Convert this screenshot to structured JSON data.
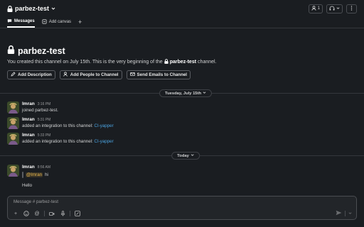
{
  "header": {
    "channel_name": "parbez-test",
    "member_count": "1"
  },
  "tabs": [
    {
      "label": "Messages"
    },
    {
      "label": "Add canvas"
    }
  ],
  "intro": {
    "title": "parbez-test",
    "desc_prefix": "You created this channel on July 15th. This is the very beginning of the",
    "desc_channel": "parbez-test",
    "desc_suffix": "channel.",
    "actions": [
      {
        "label": "Add Description"
      },
      {
        "label": "Add People to Channel"
      },
      {
        "label": "Send Emails to Channel"
      }
    ]
  },
  "date_dividers": [
    {
      "label": "Tuesday, July 15th"
    },
    {
      "label": "Today"
    }
  ],
  "messages": [
    {
      "author": "Imran",
      "time": "3:16 PM",
      "text": "joined parbez-test."
    },
    {
      "author": "Imran",
      "time": "5:31 PM",
      "text": "added an integration to this channel:",
      "link": "CI-yapper"
    },
    {
      "author": "Imran",
      "time": "5:33 PM",
      "text": "added an integration to this channel:",
      "link": "CI-yapper"
    },
    {
      "author": "Imran",
      "time": "8:56 AM",
      "mention": "@Imran",
      "quote_text": "hi",
      "reply": "Hello"
    }
  ],
  "composer": {
    "placeholder": "Message # parbez-test"
  },
  "colors": {
    "background": "#1a1d21",
    "link": "#4aa3e0",
    "mention": "#e8b74d"
  }
}
